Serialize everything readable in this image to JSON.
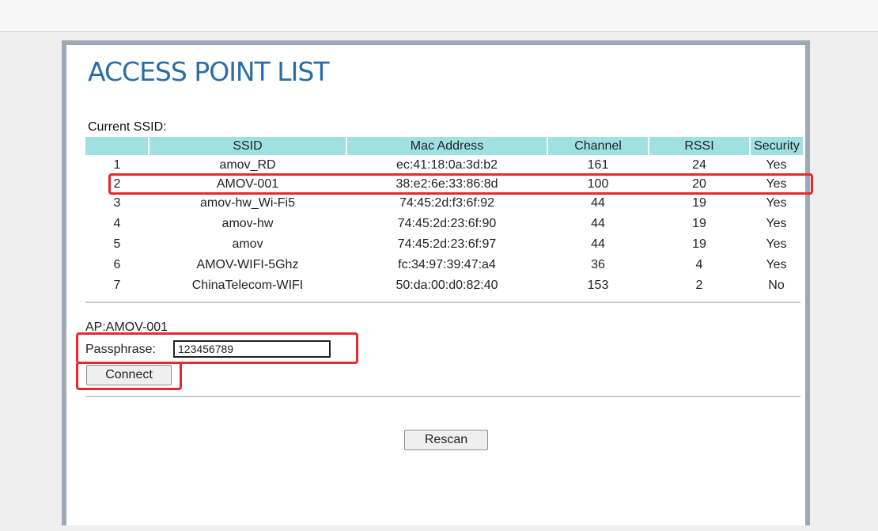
{
  "page": {
    "title": "ACCESS POINT LIST",
    "current_ssid_label": "Current SSID:"
  },
  "ap_table": {
    "columns": [
      "",
      "SSID",
      "Mac Address",
      "Channel",
      "RSSI",
      "Security"
    ],
    "rows": [
      {
        "num": "1",
        "ssid": "amov_RD",
        "mac": "ec:41:18:0a:3d:b2",
        "channel": "161",
        "rssi": "24",
        "security": "Yes"
      },
      {
        "num": "2",
        "ssid": "AMOV-001",
        "mac": "38:e2:6e:33:86:8d",
        "channel": "100",
        "rssi": "20",
        "security": "Yes"
      },
      {
        "num": "3",
        "ssid": "amov-hw_Wi-Fi5",
        "mac": "74:45:2d:f3:6f:92",
        "channel": "44",
        "rssi": "19",
        "security": "Yes"
      },
      {
        "num": "4",
        "ssid": "amov-hw",
        "mac": "74:45:2d:23:6f:90",
        "channel": "44",
        "rssi": "19",
        "security": "Yes"
      },
      {
        "num": "5",
        "ssid": "amov",
        "mac": "74:45:2d:23:6f:97",
        "channel": "44",
        "rssi": "19",
        "security": "Yes"
      },
      {
        "num": "6",
        "ssid": "AMOV-WIFI-5Ghz",
        "mac": "fc:34:97:39:47:a4",
        "channel": "36",
        "rssi": "4",
        "security": "Yes"
      },
      {
        "num": "7",
        "ssid": "ChinaTelecom-WIFI",
        "mac": "50:da:00:d0:82:40",
        "channel": "153",
        "rssi": "2",
        "security": "No"
      }
    ]
  },
  "connect_form": {
    "ap_label": "AP:AMOV-001",
    "passphrase_label": "Passphrase:",
    "passphrase_value": "123456789",
    "connect_label": "Connect"
  },
  "rescan_label": "Rescan",
  "colors": {
    "title": "#2e6da4",
    "table_header_bg": "#9fe1e3",
    "highlight_border": "#e8282f",
    "panel_border": "#9fa9b5"
  }
}
